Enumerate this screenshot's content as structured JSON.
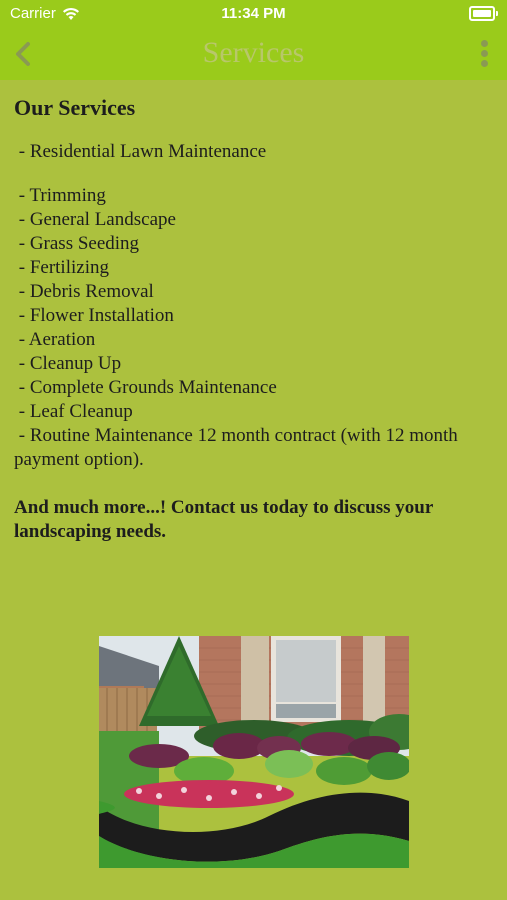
{
  "status_bar": {
    "carrier": "Carrier",
    "time": "11:34 PM"
  },
  "nav": {
    "title": "Services",
    "back_icon": "chevron-left-icon",
    "menu_icon": "vertical-ellipsis-icon"
  },
  "content": {
    "heading": "Our Services",
    "primary_service": " - Residential Lawn Maintenance",
    "services": [
      " - Trimming",
      " - General Landscape",
      " - Grass Seeding",
      " - Fertilizing",
      " - Debris Removal",
      " - Flower Installation",
      " - Aeration",
      " - Cleanup Up",
      " - Complete Grounds Maintenance",
      " - Leaf Cleanup"
    ],
    "routine": " - Routine Maintenance 12 month contract (with 12 month payment option).",
    "closing": "And much more...! Contact us today to discuss your landscaping needs."
  },
  "colors": {
    "nav_bg": "#9acb1b",
    "page_bg": "#acc13e"
  }
}
